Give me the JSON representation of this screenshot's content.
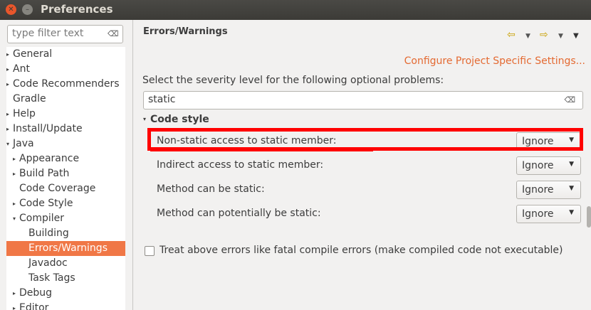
{
  "window": {
    "title": "Preferences"
  },
  "sidebar": {
    "filter_placeholder": "type filter text",
    "items": [
      {
        "label": "General",
        "arrow": "▸",
        "indent": 0
      },
      {
        "label": "Ant",
        "arrow": "▸",
        "indent": 0
      },
      {
        "label": "Code Recommenders",
        "arrow": "▸",
        "indent": 0
      },
      {
        "label": "Gradle",
        "arrow": "",
        "indent": 0
      },
      {
        "label": "Help",
        "arrow": "▸",
        "indent": 0
      },
      {
        "label": "Install/Update",
        "arrow": "▸",
        "indent": 0
      },
      {
        "label": "Java",
        "arrow": "▾",
        "indent": 0
      },
      {
        "label": "Appearance",
        "arrow": "▸",
        "indent": 1
      },
      {
        "label": "Build Path",
        "arrow": "▸",
        "indent": 1
      },
      {
        "label": "Code Coverage",
        "arrow": "",
        "indent": 1
      },
      {
        "label": "Code Style",
        "arrow": "▸",
        "indent": 1
      },
      {
        "label": "Compiler",
        "arrow": "▾",
        "indent": 1
      },
      {
        "label": "Building",
        "arrow": "",
        "indent": 2
      },
      {
        "label": "Errors/Warnings",
        "arrow": "",
        "indent": 2,
        "selected": true
      },
      {
        "label": "Javadoc",
        "arrow": "",
        "indent": 2
      },
      {
        "label": "Task Tags",
        "arrow": "",
        "indent": 2
      },
      {
        "label": "Debug",
        "arrow": "▸",
        "indent": 1
      },
      {
        "label": "Editor",
        "arrow": "▸",
        "indent": 1
      }
    ]
  },
  "main": {
    "title": "Errors/Warnings",
    "config_link": "Configure Project Specific Settings...",
    "severity_label": "Select the severity level for the following optional problems:",
    "search_value": "static",
    "section_label": "Code style",
    "options": [
      {
        "label": "Non-static access to static member:",
        "value": "Ignore"
      },
      {
        "label": "Indirect access to static member:",
        "value": "Ignore"
      },
      {
        "label": "Method can be static:",
        "value": "Ignore"
      },
      {
        "label": "Method can potentially be static:",
        "value": "Ignore"
      }
    ],
    "checkbox_label": "Treat above errors like fatal compile errors (make compiled code not executable)",
    "checkbox_checked": false
  },
  "colors": {
    "accent": "#f07746",
    "link": "#e46a32",
    "highlight": "#ff0000",
    "titlebar": "#3c3b37"
  }
}
